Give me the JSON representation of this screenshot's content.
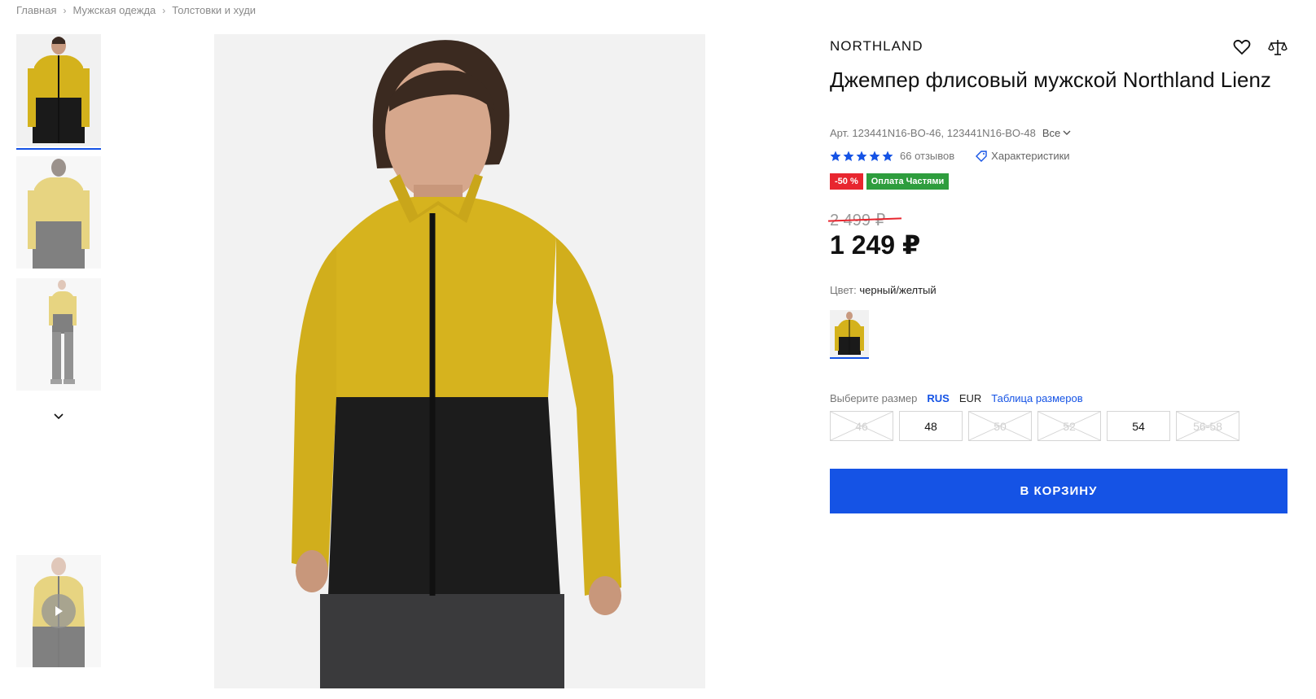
{
  "breadcrumb": [
    "Главная",
    "Мужская одежда",
    "Толстовки и худи"
  ],
  "gallery": {
    "thumbnails": [
      "front",
      "back",
      "full-body",
      "video"
    ],
    "active_index": 0
  },
  "product": {
    "brand": "NORTHLAND",
    "title": "Джемпер флисовый мужской Northland Lienz",
    "article": "Арт. 123441N16-BO-46, 123441N16-BO-48",
    "article_all": "Все",
    "rating": 5,
    "reviews": "66 отзывов",
    "specs": "Характеристики",
    "badge_discount": "-50 %",
    "badge_installments": "Оплата Частями",
    "old_price": "2 499 ₽",
    "price": "1 249 ₽",
    "color_label": "Цвет:",
    "color_value": "черный/желтый"
  },
  "size_selector": {
    "label": "Выберите размер",
    "system_rus": "RUS",
    "system_eur": "EUR",
    "table_link": "Таблица размеров",
    "sizes": [
      {
        "label": "46",
        "available": false
      },
      {
        "label": "48",
        "available": true
      },
      {
        "label": "50",
        "available": false
      },
      {
        "label": "52",
        "available": false
      },
      {
        "label": "54",
        "available": true
      },
      {
        "label": "56-58",
        "available": false
      }
    ]
  },
  "cart_button": "В КОРЗИНУ",
  "colors": {
    "accent": "#1553e5",
    "discount": "#e8262f",
    "installments": "#2e9d3d",
    "jacket_yellow": "#d4b21c",
    "jacket_black": "#1a1a1a"
  }
}
